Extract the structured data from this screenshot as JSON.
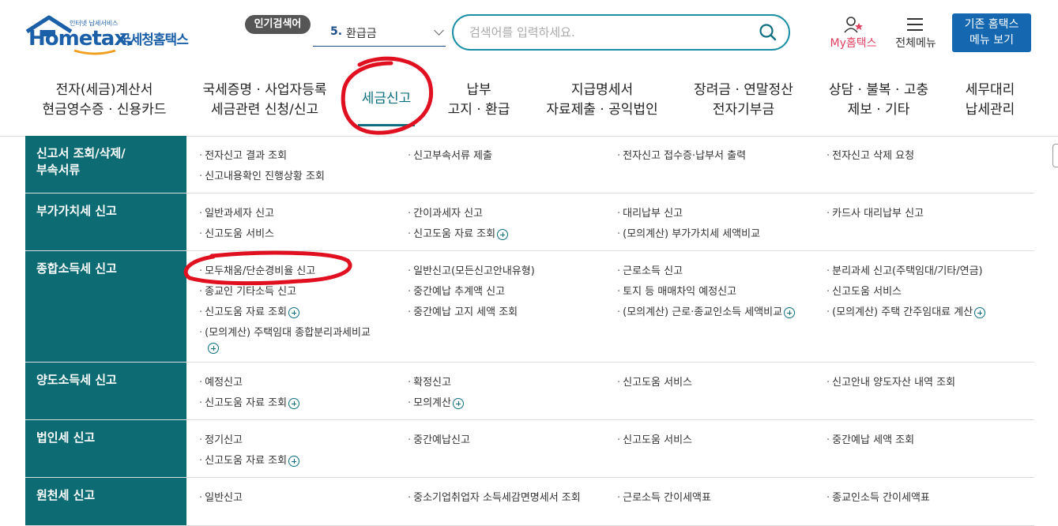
{
  "header": {
    "logo_text": "Hometax.",
    "logo_ko": "국세청홈택스",
    "logo_tiny": "인터넷 납세서비스",
    "popular_badge": "인기검색어",
    "popular_num": "5.",
    "popular_keyword": "환급금",
    "search_placeholder": "검색어를 입력하세요.",
    "my_hometax": "My홈택스",
    "all_menu": "전체메뉴",
    "old_button_line1": "기존 홈택스",
    "old_button_line2": "메뉴 보기"
  },
  "nav": [
    {
      "line1": "전자(세금)계산서",
      "line2": "현금영수증 · 신용카드"
    },
    {
      "line1": "국세증명 · 사업자등록",
      "line2": "세금관련 신청/신고"
    },
    {
      "line1": "세금신고",
      "line2": ""
    },
    {
      "line1": "납부",
      "line2": "고지 · 환급"
    },
    {
      "line1": "지급명세서",
      "line2": "자료제출 · 공익법인"
    },
    {
      "line1": "장려금 · 연말정산",
      "line2": "전자기부금"
    },
    {
      "line1": "상담 · 불복 · 고충",
      "line2": "제보 · 기타"
    },
    {
      "line1": "세무대리",
      "line2": "납세관리"
    }
  ],
  "menu": [
    {
      "cat": "신고서 조회/삭제/\n부속서류",
      "items": [
        "전자신고 결과 조회",
        "신고부속서류 제출",
        "전자신고 접수증·납부서 출력",
        "전자신고 삭제 요청",
        "신고내용확인 진행상황 조회"
      ]
    },
    {
      "cat": "부가가치세 신고",
      "items": [
        "일반과세자 신고",
        "간이과세자 신고",
        "대리납부 신고",
        "카드사 대리납부 신고",
        "신고도움 서비스",
        "신고도움 자료 조회",
        "(모의계산) 부가가치세 세액비교"
      ]
    },
    {
      "cat": "종합소득세 신고",
      "items": [
        "모두채움/단순경비율 신고",
        "일반신고(모든신고안내유형)",
        "근로소득 신고",
        "분리과세 신고(주택임대/기타/연금)",
        "종교인 기타소득 신고",
        "중간예납 추계액 신고",
        "토지 등 매매차익 예정신고",
        "신고도움 서비스",
        "신고도움 자료 조회",
        "중간예납 고지 세액 조회",
        "(모의계산) 근로·종교인소득 세액비교",
        "(모의계산) 주택 간주임대료 계산",
        "(모의계산) 주택임대 종합분리과세비교"
      ]
    },
    {
      "cat": "양도소득세 신고",
      "items": [
        "예정신고",
        "확정신고",
        "신고도움 서비스",
        "신고안내 양도자산 내역 조회",
        "신고도움 자료 조회",
        "모의계산"
      ]
    },
    {
      "cat": "법인세 신고",
      "items": [
        "정기신고",
        "중간예납신고",
        "신고도움 서비스",
        "중간예납 세액 조회",
        "신고도움 자료 조회"
      ]
    },
    {
      "cat": "원천세 신고",
      "items": [
        "일반신고",
        "중소기업취업자 소득세감면명세서 조회",
        "근로소득 간이세액표",
        "종교인소득 간이세액표"
      ]
    }
  ]
}
